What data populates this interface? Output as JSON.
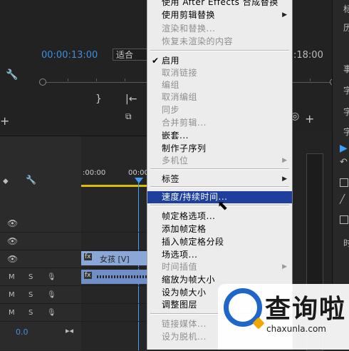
{
  "monitor": {
    "timecode_left": "00:00:13:00",
    "timecode_right": ":18:00",
    "fit_label": "适合"
  },
  "right_panel": {
    "labels": [
      "标",
      "历",
      "事",
      "字",
      "字",
      "字",
      "时"
    ]
  },
  "timeline": {
    "ruler_labels": [
      ":00:00",
      "00:00"
    ],
    "clip_video_label": "女孩 [V]",
    "track_m": "M",
    "track_s": "S",
    "value_left": "0.0"
  },
  "context_menu": {
    "items": [
      {
        "label": "使用 After Effects 合成替换",
        "state": "enabled",
        "top": 0
      },
      {
        "label": "使用剪辑替换",
        "state": "enabled",
        "submenu": true
      },
      {
        "label": "渲染和替换...",
        "state": "disabled"
      },
      {
        "label": "恢复未渲染的内容",
        "state": "disabled"
      },
      {
        "label": "启用",
        "state": "checked"
      },
      {
        "label": "取消链接",
        "state": "disabled"
      },
      {
        "label": "编组",
        "state": "disabled"
      },
      {
        "label": "取消编组",
        "state": "disabled"
      },
      {
        "label": "同步",
        "state": "disabled"
      },
      {
        "label": "合并剪辑...",
        "state": "disabled"
      },
      {
        "label": "嵌套...",
        "state": "enabled"
      },
      {
        "label": "制作子序列",
        "state": "enabled"
      },
      {
        "label": "多机位",
        "state": "disabled",
        "submenu": true
      },
      {
        "label": "标签",
        "state": "enabled",
        "submenu": true
      },
      {
        "label": "速度/持续时间...",
        "state": "highlighted"
      },
      {
        "label": "帧定格选项...",
        "state": "enabled"
      },
      {
        "label": "添加帧定格",
        "state": "enabled"
      },
      {
        "label": "插入帧定格分段",
        "state": "enabled"
      },
      {
        "label": "场选项...",
        "state": "enabled"
      },
      {
        "label": "时间插值",
        "state": "disabled",
        "submenu": true
      },
      {
        "label": "缩放为帧大小",
        "state": "enabled"
      },
      {
        "label": "设为帧大小",
        "state": "enabled"
      },
      {
        "label": "调整图层",
        "state": "enabled"
      },
      {
        "label": "链接媒体...",
        "state": "disabled"
      },
      {
        "label": "设为脱机...",
        "state": "disabled"
      }
    ]
  },
  "watermark": {
    "brand": "查询啦",
    "url": "chaxunla.com"
  },
  "colors": {
    "accent_timecode": "#3d8fe0",
    "menu_highlight": "#1f3f9e",
    "clip_video": "#8aa7d8",
    "clip_audio": "#6f8fc6"
  }
}
